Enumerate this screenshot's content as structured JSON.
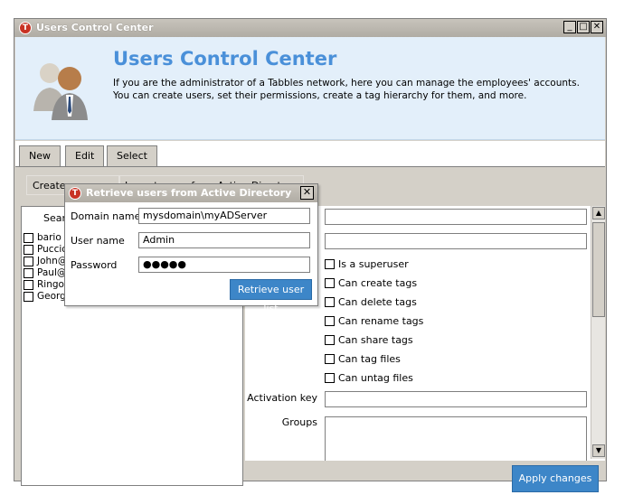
{
  "window": {
    "title": "Users Control Center",
    "controls": {
      "minimize": "_",
      "maximize": "□",
      "close": "✕"
    }
  },
  "header": {
    "title": "Users Control Center",
    "description": "If you are the administrator of a Tabbles network, here you can manage the employees' accounts. You can create users, set their permissions, create a tag hierarchy for them, and more."
  },
  "tabs": [
    {
      "label": "New",
      "active": true
    },
    {
      "label": "Edit",
      "active": false
    },
    {
      "label": "Select",
      "active": false
    }
  ],
  "toolbar": {
    "create_user": "Create new user",
    "import_ad": "Import users from Active Directory"
  },
  "left": {
    "search_label": "Searc",
    "users": [
      "bario",
      "Puccio",
      "John@",
      "Paul@r",
      "Ringo@",
      "George"
    ]
  },
  "right": {
    "checkboxes": [
      "Is a superuser",
      "Can create tags",
      "Can delete tags",
      "Can rename tags",
      "Can share tags",
      "Can tag files",
      "Can untag files"
    ],
    "activation_label": "Activation key",
    "groups_label": "Groups"
  },
  "apply_button": "Apply changes",
  "dialog": {
    "title": "Retrieve users from Active Directory",
    "close": "✕",
    "domain_label": "Domain name",
    "domain_value": "mysdomain\\myADServer",
    "user_label": "User name",
    "user_value": "Admin",
    "password_label": "Password",
    "password_value": "●●●●●",
    "retrieve_button": "Retrieve user list"
  },
  "colors": {
    "header_bg": "#e3effa",
    "header_title": "#4a90d9",
    "accent_button": "#3d86c8",
    "logo_red": "#c83224"
  }
}
